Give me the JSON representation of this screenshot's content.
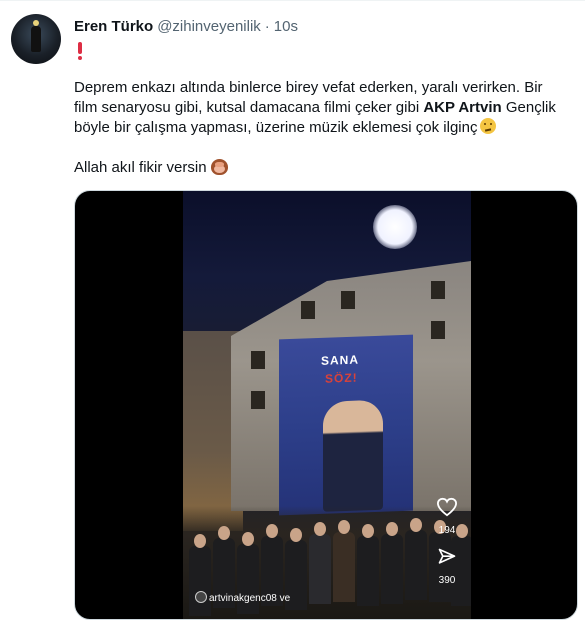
{
  "tweet": {
    "author_name": "Eren Türko",
    "handle": "@zihinveyenilik",
    "separator": "·",
    "time": "10s",
    "exclaim_icon": "red-exclamation-icon",
    "text_line1": "Deprem enkazı altında binlerce birey vefat ederken, yaralı verirken. Bir",
    "text_line2": "film senaryosu gibi, kutsal damacana filmi çeker gibi",
    "text_bold": "AKP Artvin",
    "text_line2_end": "Gençlik",
    "text_line3": "böyle bir çalışma yapması, üzerine müzik eklemesi çok ilginç",
    "line3_emoji": "confused-face-icon",
    "text_line4": "Allah akıl fikir versin",
    "line4_emoji": "see-no-evil-monkey-icon"
  },
  "media": {
    "banner_text1": "SANA",
    "banner_text2": "SÖZ!",
    "likes": "194",
    "shares": "390",
    "account_label": "artvinakgenc08 ve"
  }
}
